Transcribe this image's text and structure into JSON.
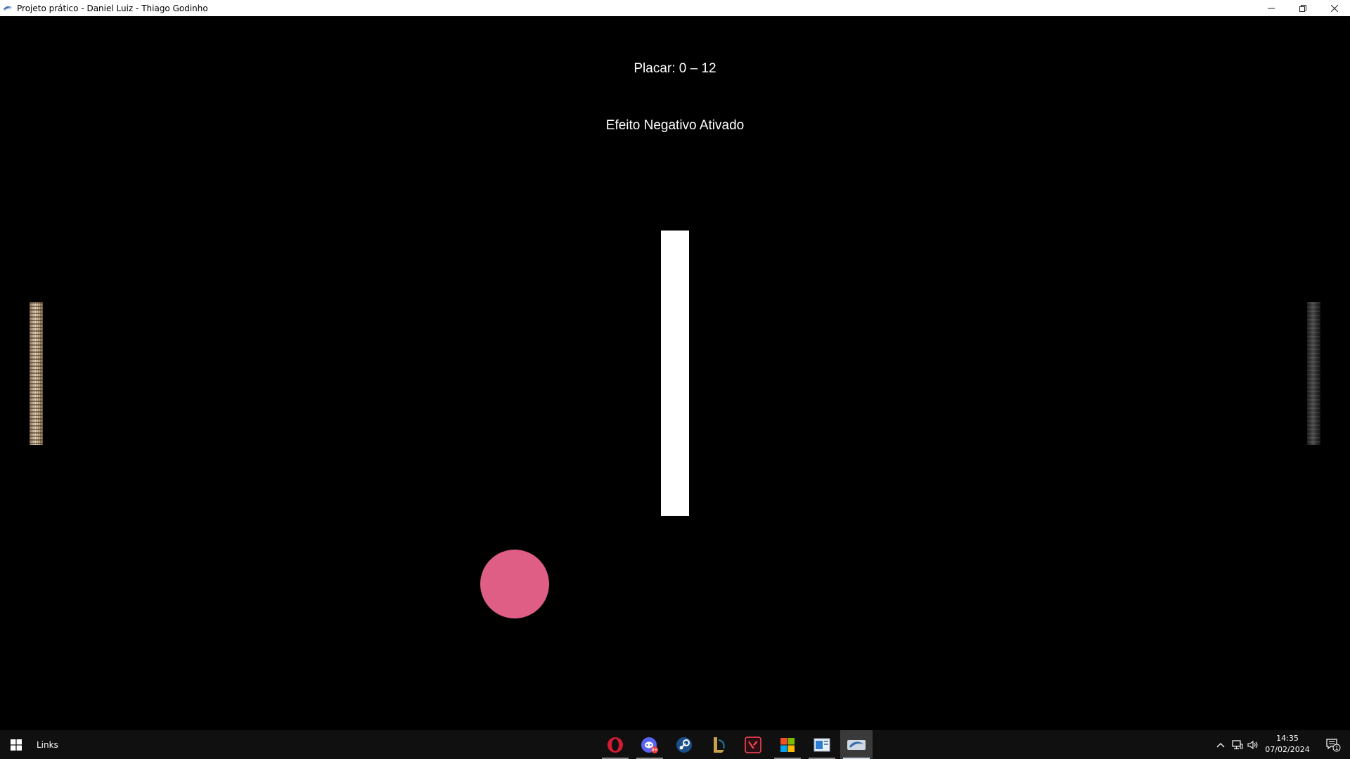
{
  "window": {
    "title": "Projeto prático - Daniel Luiz - Thiago Godinho",
    "controls": {
      "minimize": "—",
      "restore": "❐",
      "close": "✕"
    }
  },
  "game": {
    "score_text": "Placar: 0 – 12",
    "effect_text": "Efeito Negativo Ativado",
    "ball_color": "#de5e86",
    "divider_color": "#ffffff",
    "left_paddle_texture": "light-wood",
    "right_paddle_texture": "dark-wood"
  },
  "taskbar": {
    "links_label": "Links",
    "apps": [
      {
        "name": "opera-icon"
      },
      {
        "name": "discord-icon",
        "badge": "9+"
      },
      {
        "name": "steam-icon"
      },
      {
        "name": "league-of-legends-icon"
      },
      {
        "name": "valorant-icon"
      },
      {
        "name": "microsoft-store-icon"
      },
      {
        "name": "file-explorer-icon"
      },
      {
        "name": "game-window-icon"
      }
    ],
    "clock": {
      "time": "14:35",
      "date": "07/02/2024"
    },
    "notification_count": "1"
  }
}
